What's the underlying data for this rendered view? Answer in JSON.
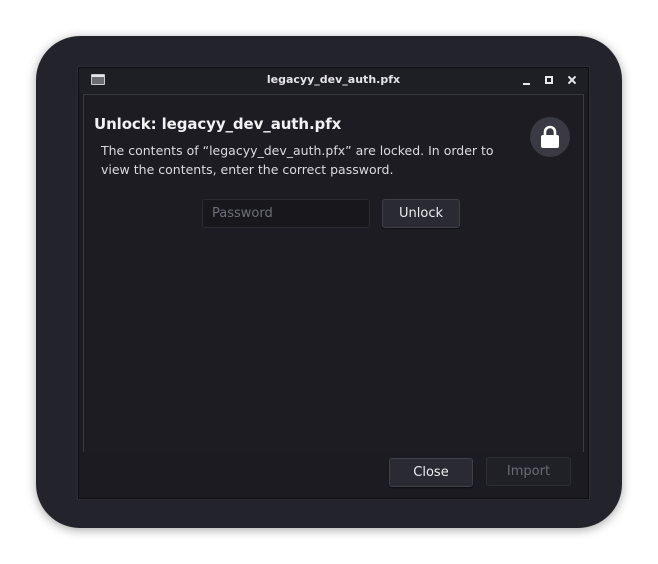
{
  "window": {
    "title": "legacyy_dev_auth.pfx",
    "app_icon": "window-icon",
    "controls": {
      "minimize_icon": "minimize-icon",
      "maximize_icon": "maximize-icon",
      "close_icon": "close-icon"
    }
  },
  "dialog": {
    "heading": "Unlock: legacyy_dev_auth.pfx",
    "description": "The contents of “legacyy_dev_auth.pfx” are locked. In order to view the contents, enter the correct password.",
    "lock_icon": "lock-icon",
    "password": {
      "value": "",
      "placeholder": "Password"
    },
    "unlock_label": "Unlock"
  },
  "footer": {
    "close_label": "Close",
    "import_label": "Import"
  },
  "colors": {
    "desktop_bg": "#23232b",
    "window_bg": "#1b1b21",
    "text": "#dadadf",
    "disabled_text": "#6a6a74"
  }
}
